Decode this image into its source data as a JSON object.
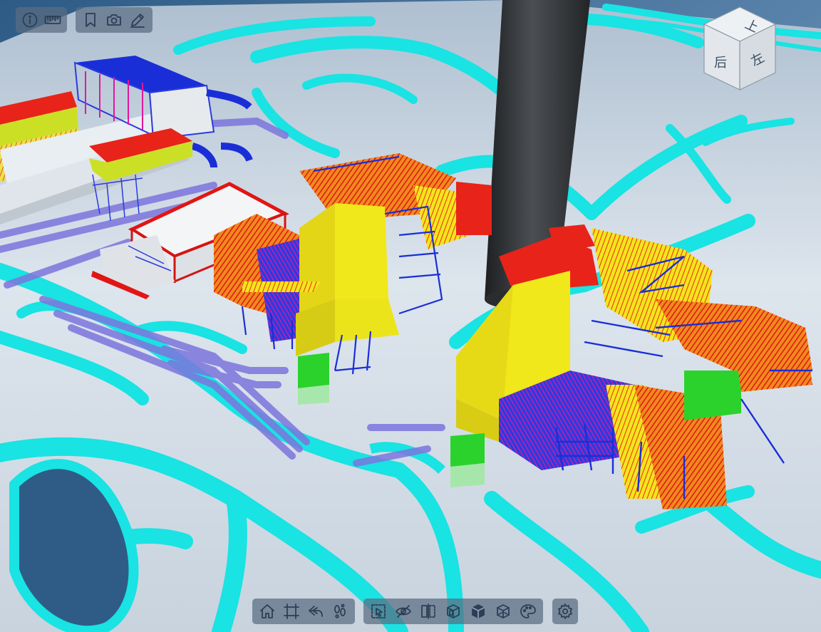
{
  "viewer": {
    "canvas_name": "3d-model-viewport"
  },
  "toolbars": {
    "top_left_a": [
      {
        "name": "info-button",
        "icon": "info-icon"
      },
      {
        "name": "measure-button",
        "icon": "ruler-icon"
      }
    ],
    "top_left_b": [
      {
        "name": "bookmark-button",
        "icon": "bookmark-icon"
      },
      {
        "name": "screenshot-button",
        "icon": "camera-icon"
      },
      {
        "name": "markup-button",
        "icon": "pencil-icon"
      }
    ],
    "bottom_nav": [
      {
        "name": "home-button",
        "icon": "home-icon"
      },
      {
        "name": "fit-view-button",
        "icon": "frame-select-icon"
      },
      {
        "name": "undo-view-button",
        "icon": "return-arrow-icon"
      },
      {
        "name": "walk-mode-button",
        "icon": "footprints-icon"
      }
    ],
    "bottom_view": [
      {
        "name": "select-button",
        "icon": "box-select-icon"
      },
      {
        "name": "hide-button",
        "icon": "eye-slash-icon"
      },
      {
        "name": "section-button",
        "icon": "section-plane-icon"
      },
      {
        "name": "section-box-button",
        "icon": "section-box-icon"
      },
      {
        "name": "isolate-button",
        "icon": "solid-cube-icon"
      },
      {
        "name": "explode-button",
        "icon": "wire-cube-icon"
      },
      {
        "name": "appearance-button",
        "icon": "palette-icon"
      }
    ],
    "bottom_settings": [
      {
        "name": "settings-button",
        "icon": "gear-icon"
      }
    ]
  },
  "viewcube": {
    "faces": {
      "top": "上",
      "front": "后",
      "side": "左"
    }
  },
  "colors": {
    "road": "#19e3e3",
    "ground": "#d5dde6",
    "background": "#1e3f66",
    "stack": "#3a3d40",
    "structure_yellow": "#f0e81a",
    "structure_red": "#ee1f1f",
    "structure_blue": "#1a2ed8",
    "structure_magenta": "#d6189a",
    "structure_green": "#2bd22b",
    "toolbar_bg": "rgba(90,108,130,0.72)"
  }
}
